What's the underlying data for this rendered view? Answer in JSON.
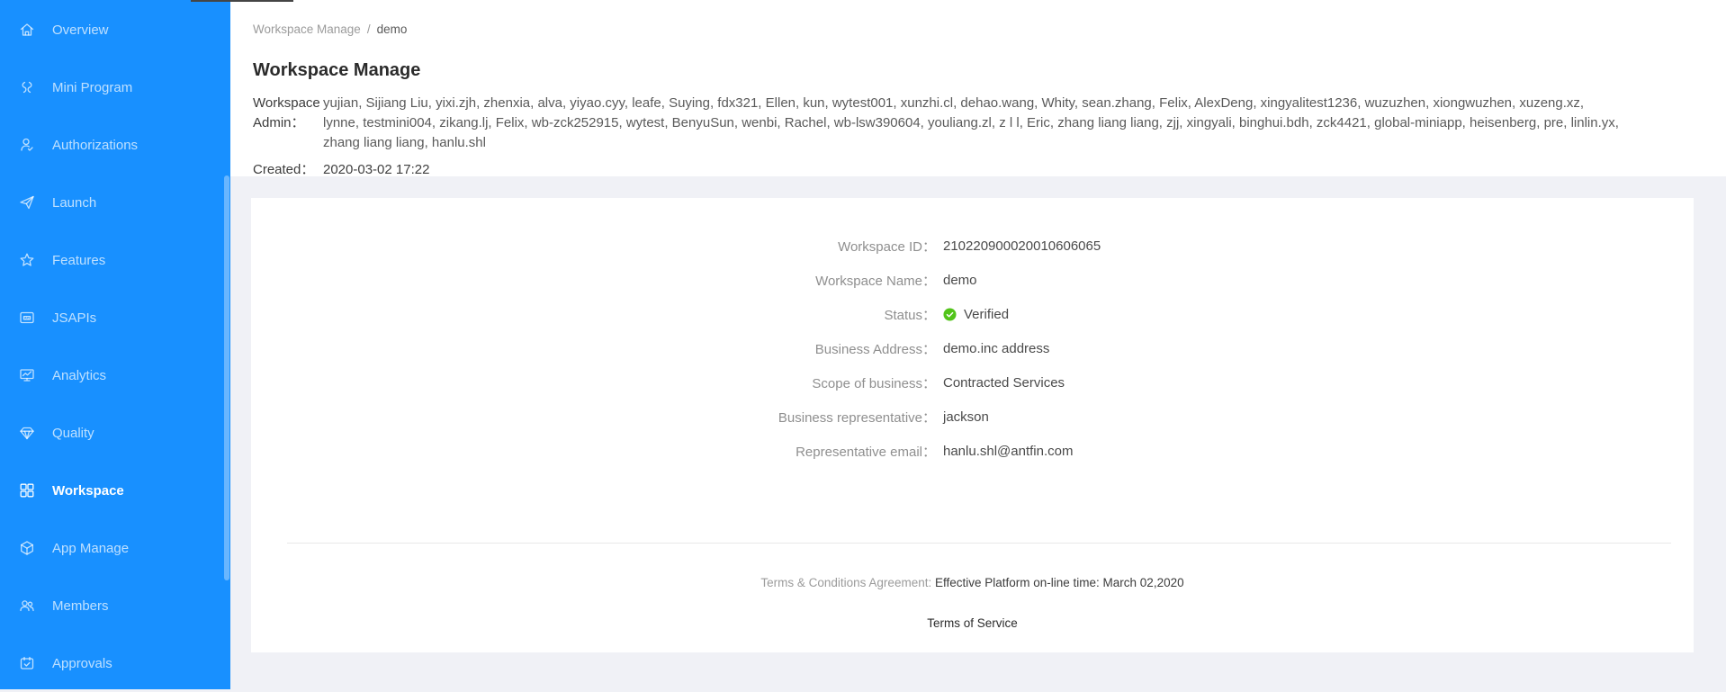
{
  "colors": {
    "sidebar_blue": "#1890ff",
    "verified_green": "#52c41a"
  },
  "sidebar": {
    "items": [
      {
        "label": "Overview",
        "icon": "home-icon",
        "active": false
      },
      {
        "label": "Mini Program",
        "icon": "mini-program-icon",
        "active": false
      },
      {
        "label": "Authorizations",
        "icon": "user-check-icon",
        "active": false
      },
      {
        "label": "Launch",
        "icon": "paper-plane-icon",
        "active": false
      },
      {
        "label": "Features",
        "icon": "star-icon",
        "active": false
      },
      {
        "label": "JSAPIs",
        "icon": "api-icon",
        "active": false
      },
      {
        "label": "Analytics",
        "icon": "analytics-chart-icon",
        "active": false
      },
      {
        "label": "Quality",
        "icon": "gem-icon",
        "active": false
      },
      {
        "label": "Workspace",
        "icon": "grid-icon",
        "active": true
      },
      {
        "label": "App Manage",
        "icon": "cube-icon",
        "active": false
      },
      {
        "label": "Members",
        "icon": "members-icon",
        "active": false
      },
      {
        "label": "Approvals",
        "icon": "calendar-check-icon",
        "active": false
      }
    ]
  },
  "breadcrumb": {
    "parent": "Workspace Manage",
    "separator": "/",
    "current": "demo"
  },
  "header": {
    "title": "Workspace Manage",
    "admin_label": "Workspace Admin：",
    "admin_value": "yujian, Sijiang Liu, yixi.zjh, zhenxia, alva, yiyao.cyy, leafe, Suying, fdx321, Ellen, kun, wytest001, xunzhi.cl, dehao.wang, Whity, sean.zhang, Felix, AlexDeng, xingyalitest1236, wuzuzhen, xiongwuzhen, xuzeng.xz, lynne, testmini004, zikang.lj, Felix, wb-zck252915, wytest, BenyuSun, wenbi, Rachel, wb-lsw390604, youliang.zl, z l l, Eric, zhang liang liang, zjj, xingyali, binghui.bdh, zck4421, global-miniapp, heisenberg, pre, linlin.yx, zhang liang liang, hanlu.shl",
    "created_label": "Created：",
    "created_value": "2020-03-02 17:22"
  },
  "details": {
    "fields": [
      {
        "label": "Workspace ID：",
        "value": "210220900020010606065",
        "verified": false
      },
      {
        "label": "Workspace Name：",
        "value": "demo",
        "verified": false
      },
      {
        "label": "Status：",
        "value": "Verified",
        "verified": true
      },
      {
        "label": "Business Address：",
        "value": "demo.inc address",
        "verified": false
      },
      {
        "label": "Scope of business：",
        "value": "Contracted Services",
        "verified": false
      },
      {
        "label": "Business representative：",
        "value": "jackson",
        "verified": false
      },
      {
        "label": "Representative email：",
        "value": "hanlu.shl@antfin.com",
        "verified": false
      }
    ]
  },
  "footer": {
    "terms_label": "Terms & Conditions Agreement:",
    "terms_value": " Effective Platform on-line time: March 02,2020",
    "terms_link": "Terms of Service"
  }
}
